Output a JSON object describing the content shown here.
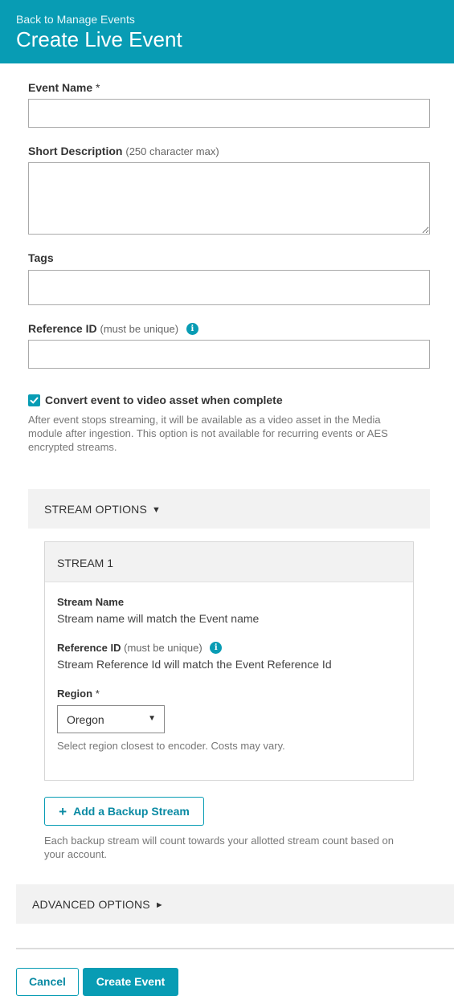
{
  "header": {
    "back_link": "Back to Manage Events",
    "title": "Create Live Event"
  },
  "form": {
    "event_name": {
      "label": "Event Name",
      "required_mark": "*",
      "value": ""
    },
    "short_description": {
      "label": "Short Description",
      "hint": "(250 character max)",
      "value": ""
    },
    "tags": {
      "label": "Tags",
      "value": ""
    },
    "reference_id": {
      "label": "Reference ID",
      "hint": "(must be unique)",
      "info_icon": "info-icon",
      "value": ""
    },
    "convert_checkbox": {
      "checked": true,
      "label": "Convert event to video asset when complete",
      "help_line1": "After event stops streaming, it will be available as a video asset in the Media",
      "help_line2": "module after ingestion. This option is not available for recurring events or AES",
      "help_line3": "encrypted streams."
    }
  },
  "stream_options": {
    "title": "STREAM OPTIONS",
    "arrow": "▼",
    "stream": {
      "title": "STREAM 1",
      "name_label": "Stream Name",
      "name_text": "Stream name will match the Event name",
      "ref_label": "Reference ID",
      "ref_hint": "(must be unique)",
      "ref_text": "Stream Reference Id will match the Event Reference Id",
      "region_label": "Region",
      "region_required": "*",
      "region_value": "Oregon",
      "region_caret": "▼",
      "region_help": "Select region closest to encoder. Costs may vary."
    },
    "add_backup_button": "Add a Backup Stream",
    "add_backup_icon": "+",
    "backup_help_line1": "Each backup stream will count towards your allotted stream count based on",
    "backup_help_line2": "your account."
  },
  "advanced_options": {
    "title": "ADVANCED OPTIONS",
    "arrow": "►"
  },
  "footer": {
    "cancel_button": "Cancel",
    "create_button": "Create Event"
  },
  "colors": {
    "accent": "#089cb4",
    "section_bg": "#f2f2f2"
  }
}
